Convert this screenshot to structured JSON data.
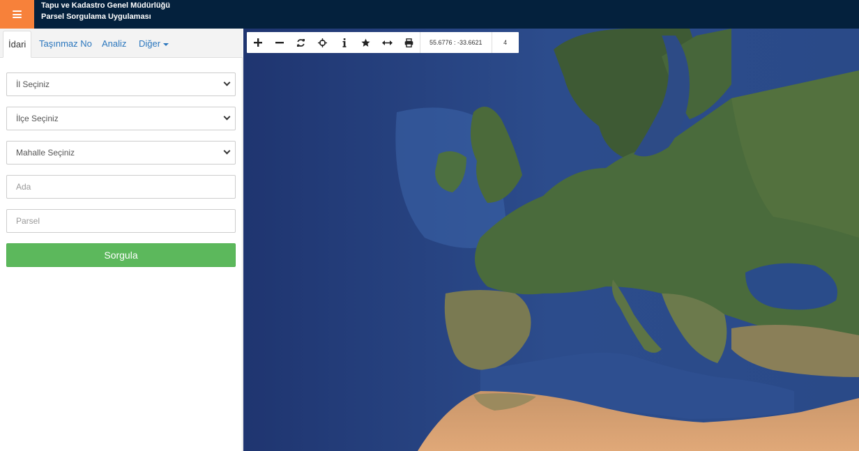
{
  "header": {
    "title_line1": "Tapu ve Kadastro Genel Müdürlüğü",
    "title_line2": "Parsel Sorgulama Uygulaması",
    "menu_icon": "hamburger-icon",
    "accent_color": "#f7813a",
    "bar_color": "#04213d"
  },
  "tabs": [
    {
      "label": "İdari",
      "active": true
    },
    {
      "label": "Taşınmaz No",
      "active": false
    },
    {
      "label": "Analiz",
      "active": false
    },
    {
      "label": "Diğer",
      "active": false
    }
  ],
  "form": {
    "il_select": "İl Seçiniz",
    "ilce_select": "İlçe Seçiniz",
    "mahalle_select": "Mahalle Seçiniz",
    "ada_placeholder": "Ada",
    "parsel_placeholder": "Parsel",
    "submit_label": "Sorgula",
    "submit_color": "#5cb85c"
  },
  "map": {
    "toolbar_icons": [
      "zoom-in-icon",
      "zoom-out-icon",
      "refresh-icon",
      "locate-icon",
      "info-icon",
      "star-icon",
      "measure-icon",
      "print-icon"
    ],
    "coordinates": "55.6776 : -33.6621",
    "zoom_level": "4"
  }
}
